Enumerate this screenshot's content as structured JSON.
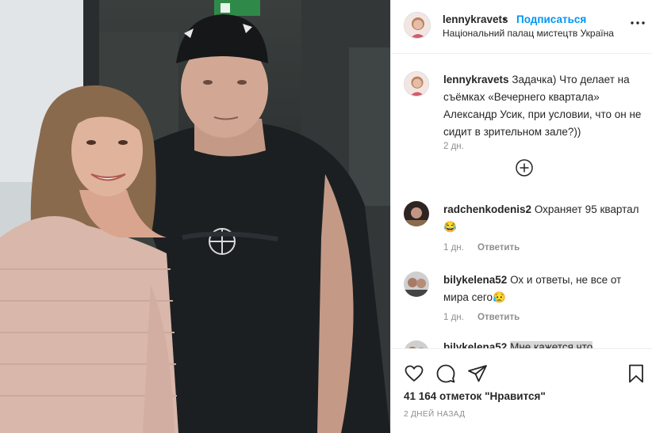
{
  "post": {
    "image_alt": "photo",
    "header": {
      "username": "lennykravets",
      "separator": "•",
      "follow_label": "Подписаться",
      "location": "Національний палац мистецтв Україна",
      "more_icon": "more-horizontal-icon"
    },
    "caption": {
      "username": "lennykravets",
      "text": "Задачка) Что делает на съёмках «Вечернего квартала» Александр Усик, при условии, что он не сидит в зрительном зале?))",
      "time": "2 дн."
    },
    "load_more_icon": "plus-circle-icon",
    "comments": [
      {
        "username": "radchenkodenis2",
        "text": "Охраняет 95 квартал😂",
        "time": "1 дн.",
        "reply_label": "Ответить"
      },
      {
        "username": "bilykelena52",
        "text": "Ох и ответы, не все от мира сего😥",
        "time": "1 дн.",
        "reply_label": "Ответить"
      },
      {
        "username": "bilykelena52",
        "text": "Мне кажется что",
        "time": "",
        "reply_label": ""
      }
    ],
    "actions": {
      "like_icon": "heart-icon",
      "comment_icon": "comment-icon",
      "share_icon": "paper-plane-icon",
      "save_icon": "bookmark-icon",
      "likes_text": "41 164 отметок \"Нравится\"",
      "date_text": "2 ДНЕЙ НАЗАД"
    },
    "colors": {
      "link": "#0095f6",
      "text": "#262626",
      "muted": "#8e8e8e"
    }
  }
}
